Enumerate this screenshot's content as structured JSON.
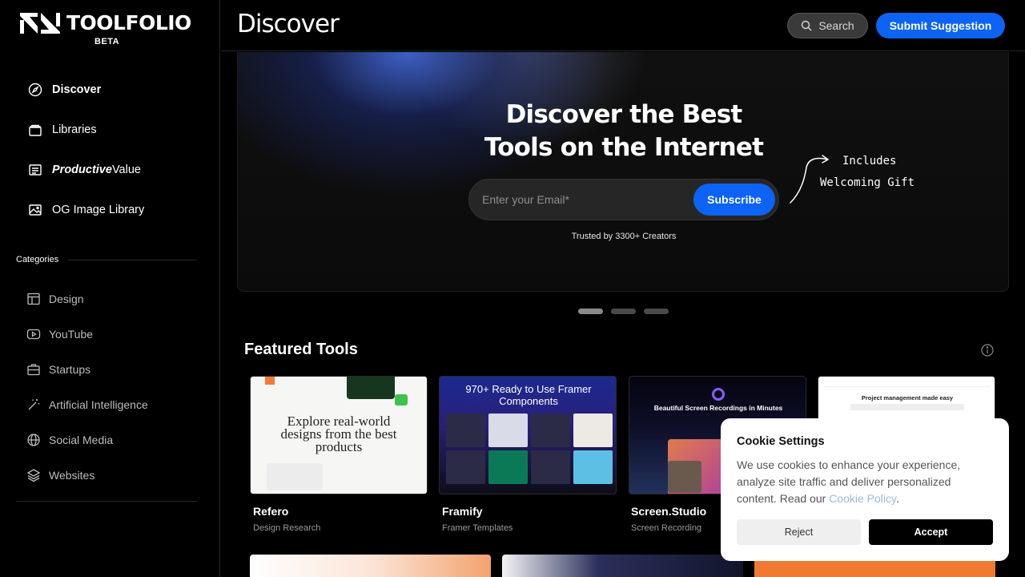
{
  "brand": {
    "name": "TOOLFOLIO",
    "badge": "BETA"
  },
  "nav": [
    {
      "icon": "compass-icon",
      "label": "Discover",
      "active": true
    },
    {
      "icon": "library-icon",
      "label": "Libraries"
    },
    {
      "icon": "newsletter-icon",
      "label_bold": "Productive",
      "label_rest": "Value"
    },
    {
      "icon": "image-icon",
      "label": "OG Image Library"
    }
  ],
  "categories_header": "Categories",
  "categories": [
    {
      "icon": "layout-icon",
      "label": "Design"
    },
    {
      "icon": "youtube-icon",
      "label": "YouTube"
    },
    {
      "icon": "briefcase-icon",
      "label": "Startups"
    },
    {
      "icon": "magic-wand-icon",
      "label": "Artificial Intelligence"
    },
    {
      "icon": "globe-icon",
      "label": "Social Media"
    },
    {
      "icon": "layers-icon",
      "label": "Websites"
    }
  ],
  "topbar": {
    "title": "Discover",
    "search_label": "Search",
    "submit_label": "Submit Suggestion"
  },
  "hero": {
    "title_line1": "Discover the Best",
    "title_line2": "Tools on the Internet",
    "email_placeholder": "Enter your Email*",
    "subscribe_label": "Subscribe",
    "trusted": "Trusted by 3300+ Creators",
    "gift_line1": "Includes",
    "gift_line2": "Welcoming Gift",
    "slides": 3,
    "active_slide": 1
  },
  "featured": {
    "title": "Featured Tools",
    "cards": [
      {
        "name": "Refero",
        "category": "Design Research",
        "thumb_text": "Explore real-world designs from the best products"
      },
      {
        "name": "Framify",
        "category": "Framer Templates",
        "thumb_text": "970+ Ready to Use Framer Components"
      },
      {
        "name": "Screen.Studio",
        "category": "Screen Recording",
        "thumb_text": "Beautiful Screen Recordings in Minutes"
      },
      {
        "name": "",
        "category": "",
        "thumb_text": "Project management made easy"
      }
    ]
  },
  "cookie": {
    "title": "Cookie Settings",
    "text": "We use cookies to enhance your experience, analyze site traffic and deliver personalized content. Read our ",
    "link": "Cookie Policy",
    "after_link": ".",
    "reject_label": "Reject",
    "accept_label": "Accept"
  },
  "colors": {
    "accent": "#0d63f3",
    "background": "#000000",
    "cookie_link": "#9db9d8"
  }
}
